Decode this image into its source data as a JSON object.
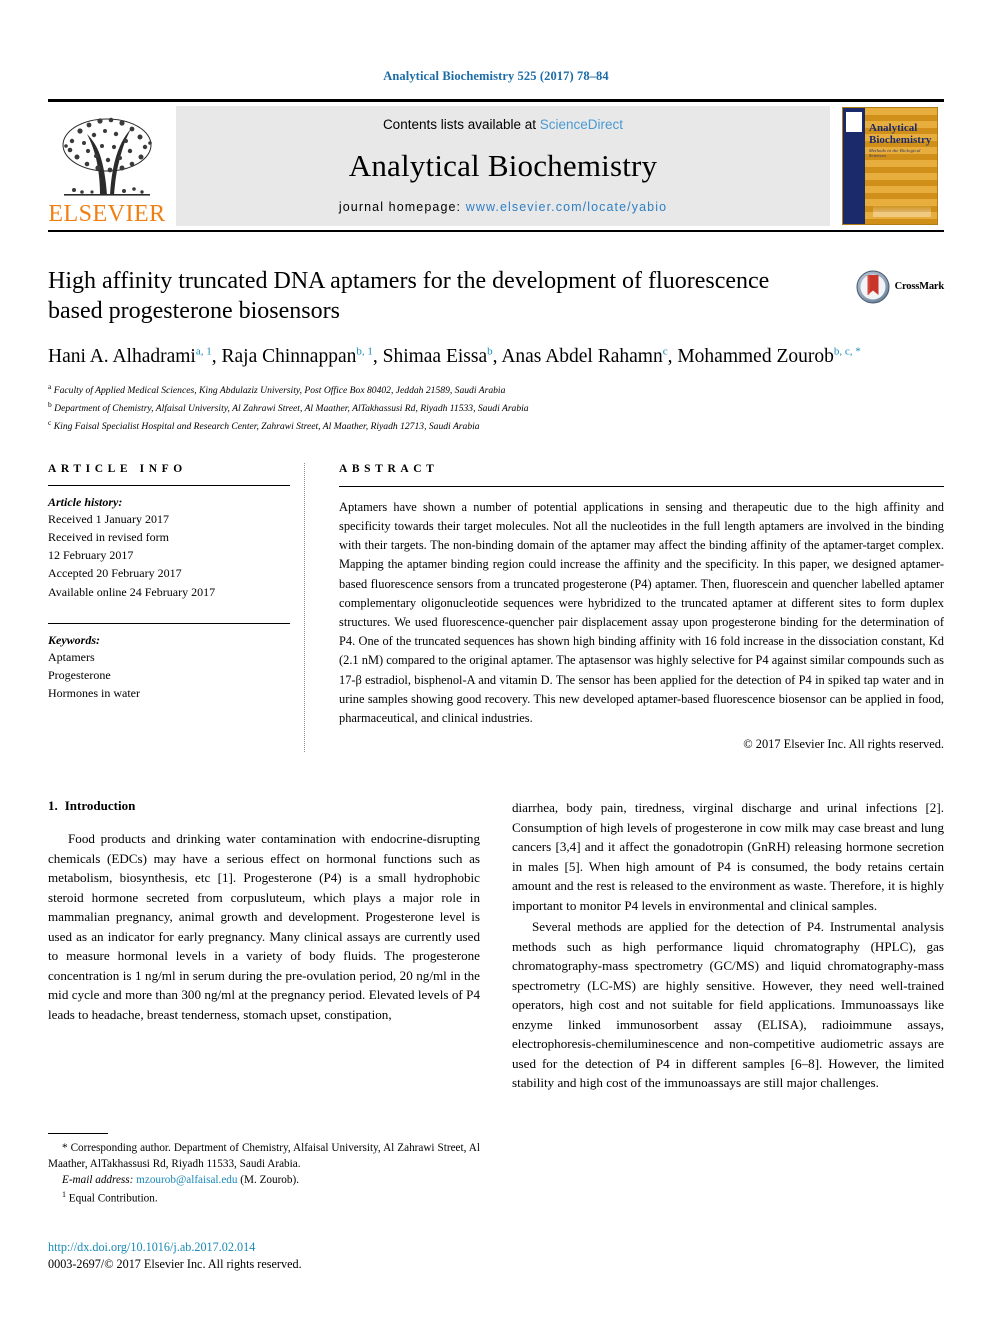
{
  "running_head": "Analytical Biochemistry 525 (2017) 78–84",
  "masthead": {
    "publisher_logo_text": "ELSEVIER",
    "contents_prefix": "Contents lists available at ",
    "contents_link": "ScienceDirect",
    "journal_name": "Analytical Biochemistry",
    "homepage_label": "journal homepage: ",
    "homepage_url": "www.elsevier.com/locate/yabio",
    "cover_title_line1": "Analytical",
    "cover_title_line2": "Biochemistry",
    "cover_subtitle": "Methods in the Biological Sciences"
  },
  "crossmark": {
    "label": "CrossMark"
  },
  "article": {
    "title": "High affinity truncated DNA aptamers for the development of fluorescence based progesterone biosensors",
    "authors": [
      {
        "name": "Hani A. Alhadrami",
        "marks": "a, 1",
        "sep": ", "
      },
      {
        "name": "Raja Chinnappan",
        "marks": "b, 1",
        "sep": ", "
      },
      {
        "name": "Shimaa Eissa",
        "marks": "b",
        "sep": ", "
      },
      {
        "name": "Anas Abdel Rahamn",
        "marks": "c",
        "sep": ", "
      },
      {
        "name": "Mohammed Zourob",
        "marks": "b, c, *",
        "sep": ""
      }
    ],
    "affiliations": [
      {
        "mark": "a",
        "text": "Faculty of Applied Medical Sciences, King Abdulaziz University, Post Office Box 80402, Jeddah 21589, Saudi Arabia"
      },
      {
        "mark": "b",
        "text": "Department of Chemistry, Alfaisal University, Al Zahrawi Street, Al Maather, AlTakhassusi Rd, Riyadh 11533, Saudi Arabia"
      },
      {
        "mark": "c",
        "text": "King Faisal Specialist Hospital and Research Center, Zahrawi Street, Al Maather, Riyadh 12713, Saudi Arabia"
      }
    ]
  },
  "article_info": {
    "section_label": "ARTICLE INFO",
    "history_label": "Article history:",
    "history": [
      "Received 1 January 2017",
      "Received in revised form",
      "12 February 2017",
      "Accepted 20 February 2017",
      "Available online 24 February 2017"
    ],
    "keywords_label": "Keywords:",
    "keywords": [
      "Aptamers",
      "Progesterone",
      "Hormones in water"
    ]
  },
  "abstract": {
    "section_label": "ABSTRACT",
    "text": "Aptamers have shown a number of potential applications in sensing and therapeutic due to the high affinity and specificity towards their target molecules. Not all the nucleotides in the full length aptamers are involved in the binding with their targets. The non-binding domain of the aptamer may affect the binding affinity of the aptamer-target complex. Mapping the aptamer binding region could increase the affinity and the specificity. In this paper, we designed aptamer-based fluorescence sensors from a truncated progesterone (P4) aptamer. Then, fluorescein and quencher labelled aptamer complementary oligonucleotide sequences were hybridized to the truncated aptamer at different sites to form duplex structures. We used fluorescence-quencher pair displacement assay upon progesterone binding for the determination of P4. One of the truncated sequences has shown high binding affinity with 16 fold increase in the dissociation constant, Kd (2.1 nM) compared to the original aptamer. The aptasensor was highly selective for P4 against similar compounds such as 17-β estradiol, bisphenol-A and vitamin D. The sensor has been applied for the detection of P4 in spiked tap water and in urine samples showing good recovery. This new developed aptamer-based fluorescence biosensor can be applied in food, pharmaceutical, and clinical industries.",
    "copyright": "© 2017 Elsevier Inc. All rights reserved."
  },
  "introduction": {
    "number": "1.",
    "title": "Introduction",
    "left_paragraph": "Food products and drinking water contamination with endocrine-disrupting chemicals (EDCs) may have a serious effect on hormonal functions such as metabolism, biosynthesis, etc [1]. Progesterone (P4) is a small hydrophobic steroid hormone secreted from corpusluteum, which plays a major role in mammalian pregnancy, animal growth and development. Progesterone level is used as an indicator for early pregnancy. Many clinical assays are currently used to measure hormonal levels in a variety of body fluids. The progesterone concentration is 1 ng/ml in serum during the pre-ovulation period, 20 ng/ml in the mid cycle and more than 300 ng/ml at the pregnancy period. Elevated levels of P4 leads to headache, breast tenderness, stomach upset, constipation,",
    "right_paragraph_1": "diarrhea, body pain, tiredness, virginal discharge and urinal infections [2]. Consumption of high levels of progesterone in cow milk may case breast and lung cancers [3,4] and it affect the gonadotropin (GnRH) releasing hormone secretion in males [5]. When high amount of P4 is consumed, the body retains certain amount and the rest is released to the environment as waste. Therefore, it is highly important to monitor P4 levels in environmental and clinical samples.",
    "right_paragraph_2": "Several methods are applied for the detection of P4. Instrumental analysis methods such as high performance liquid chromatography (HPLC), gas chromatography-mass spectrometry (GC/MS) and liquid chromatography-mass spectrometry (LC-MS) are highly sensitive. However, they need well-trained operators, high cost and not suitable for field applications. Immunoassays like enzyme linked immunosorbent assay (ELISA), radioimmune assays, electrophoresis-chemiluminescence and non-competitive audiometric assays are used for the detection of P4 in different samples [6–8]. However, the limited stability and high cost of the immunoassays are still major challenges."
  },
  "footnotes": {
    "corresponding": "* Corresponding author. Department of Chemistry, Alfaisal University, Al Zahrawi Street, Al Maather, AlTakhassusi Rd, Riyadh 11533, Saudi Arabia.",
    "email_label": "E-mail address:",
    "email": "mzourob@alfaisal.edu",
    "email_suffix": "(M. Zourob).",
    "equal_contribution_mark": "1",
    "equal_contribution": "Equal Contribution.",
    "doi": "http://dx.doi.org/10.1016/j.ab.2017.02.014",
    "issn": "0003-2697/© 2017 Elsevier Inc. All rights reserved."
  },
  "colors": {
    "link_blue": "#1b89b6",
    "header_blue": "#1b6ca8",
    "sciencedirect_blue": "#4a9ad4",
    "elsevier_orange": "#f07f13",
    "cover_navy": "#1b2a6b",
    "cover_gold": "#d99b22",
    "band_gray": "#e8e8e8"
  }
}
